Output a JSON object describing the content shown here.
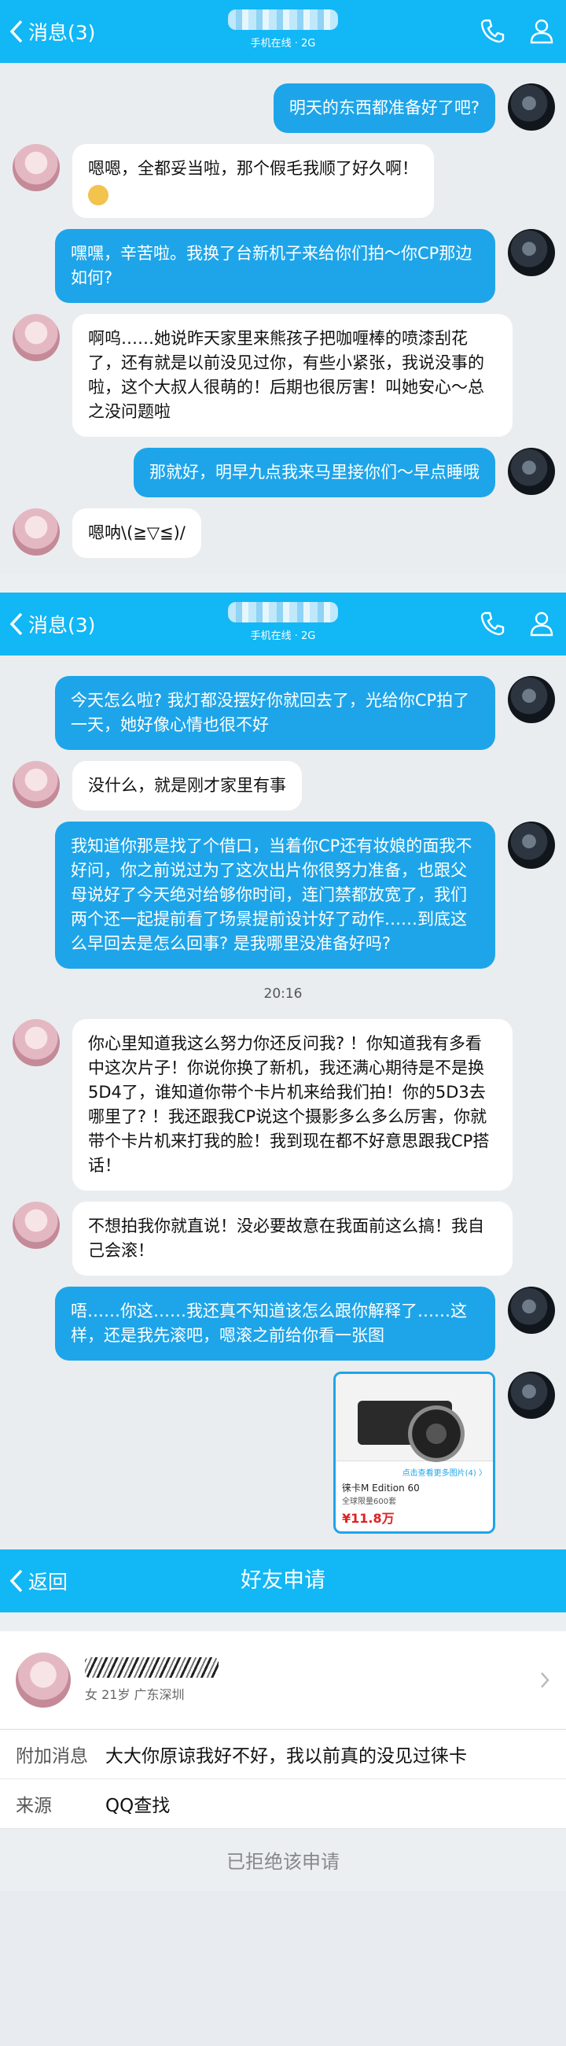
{
  "panel1": {
    "back_label": "消息(3)",
    "status": "手机在线 · 2G",
    "messages": [
      {
        "side": "right",
        "text": "明天的东西都准备好了吧?"
      },
      {
        "side": "left",
        "text": "嗯嗯，全都妥当啦，那个假毛我顺了好久啊！"
      },
      {
        "side": "right",
        "text": "嘿嘿，辛苦啦。我换了台新机子来给你们拍～你CP那边如何?"
      },
      {
        "side": "left",
        "text": "啊呜……她说昨天家里来熊孩子把咖喱棒的喷漆刮花了，还有就是以前没见过你，有些小紧张，我说没事的啦，这个大叔人很萌的！后期也很厉害！叫她安心～总之没问题啦"
      },
      {
        "side": "right",
        "text": "那就好，明早九点我来马里接你们～早点睡哦"
      },
      {
        "side": "left",
        "text": "嗯呐\\(≧▽≦)/"
      }
    ]
  },
  "panel2": {
    "back_label": "消息(3)",
    "status": "手机在线 · 2G",
    "messages_a": [
      {
        "side": "right",
        "text": "今天怎么啦? 我灯都没摆好你就回去了，光给你CP拍了一天，她好像心情也很不好"
      },
      {
        "side": "left",
        "text": "没什么，就是刚才家里有事"
      },
      {
        "side": "right",
        "text": "我知道你那是找了个借口，当着你CP还有妆娘的面我不好问，你之前说过为了这次出片你很努力准备，也跟父母说好了今天绝对给够你时间，连门禁都放宽了，我们两个还一起提前看了场景提前设计好了动作……到底这么早回去是怎么回事? 是我哪里没准备好吗?"
      }
    ],
    "time": "20:16",
    "messages_b": [
      {
        "side": "left",
        "text": "你心里知道我这么努力你还反问我? ！你知道我有多看中这次片子！你说你换了新机，我还满心期待是不是换5D4了，谁知道你带个卡片机来给我们拍！你的5D3去哪里了? ！我还跟我CP说这个摄影多么多么厉害，你就带个卡片机来打我的脸！我到现在都不好意思跟我CP搭话！"
      },
      {
        "side": "left",
        "text": "不想拍我你就直说！没必要故意在我面前这么搞！我自己会滚！"
      },
      {
        "side": "right",
        "text": "唔……你这……我还真不知道该怎么跟你解释了……这样，还是我先滚吧，嗯滚之前给你看一张图"
      }
    ],
    "card": {
      "link": "点击查看更多图片(4) 〉",
      "name": "徕卡M Edition 60",
      "limit": "全球限量600套",
      "price": "¥11.8万"
    }
  },
  "panel3": {
    "back_label": "返回",
    "title": "好友申请",
    "profile_sub": "女  21岁  广东深圳",
    "attach_key": "附加消息",
    "attach_val": "大大你原谅我好不好，我以前真的没见过徕卡",
    "source_key": "来源",
    "source_val": "QQ查找",
    "footer": "已拒绝该申请"
  },
  "colors": {
    "accent": "#12b7f5",
    "bubble_self": "#1ea5e9",
    "bubble_other": "#ffffff"
  }
}
